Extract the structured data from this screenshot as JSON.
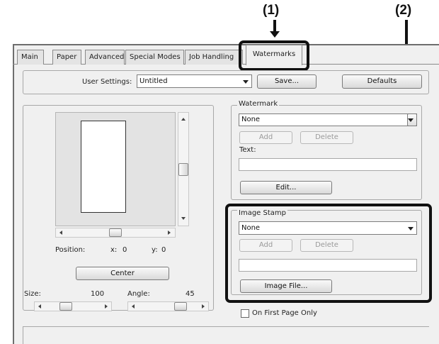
{
  "callouts": {
    "one": "(1)",
    "two": "(2)"
  },
  "tabs": [
    "Main",
    "Paper",
    "Advanced",
    "Special Modes",
    "Job Handling",
    "Watermarks"
  ],
  "user_settings": {
    "label": "User Settings:",
    "value": "Untitled",
    "save_label": "Save...",
    "defaults_label": "Defaults"
  },
  "preview": {
    "position_label": "Position:",
    "x_label": "x:",
    "x_value": "0",
    "y_label": "y:",
    "y_value": "0",
    "center_label": "Center",
    "size_label": "Size:",
    "size_value": "100",
    "angle_label": "Angle:",
    "angle_value": "45"
  },
  "watermark": {
    "legend": "Watermark",
    "selected": "None",
    "add_label": "Add",
    "delete_label": "Delete",
    "text_label": "Text:",
    "text_value": "",
    "edit_label": "Edit..."
  },
  "image_stamp": {
    "legend": "Image Stamp",
    "selected": "None",
    "add_label": "Add",
    "delete_label": "Delete",
    "file_path": "",
    "image_file_label": "Image File..."
  },
  "first_page_only": {
    "label": "On First Page Only",
    "checked": false
  }
}
